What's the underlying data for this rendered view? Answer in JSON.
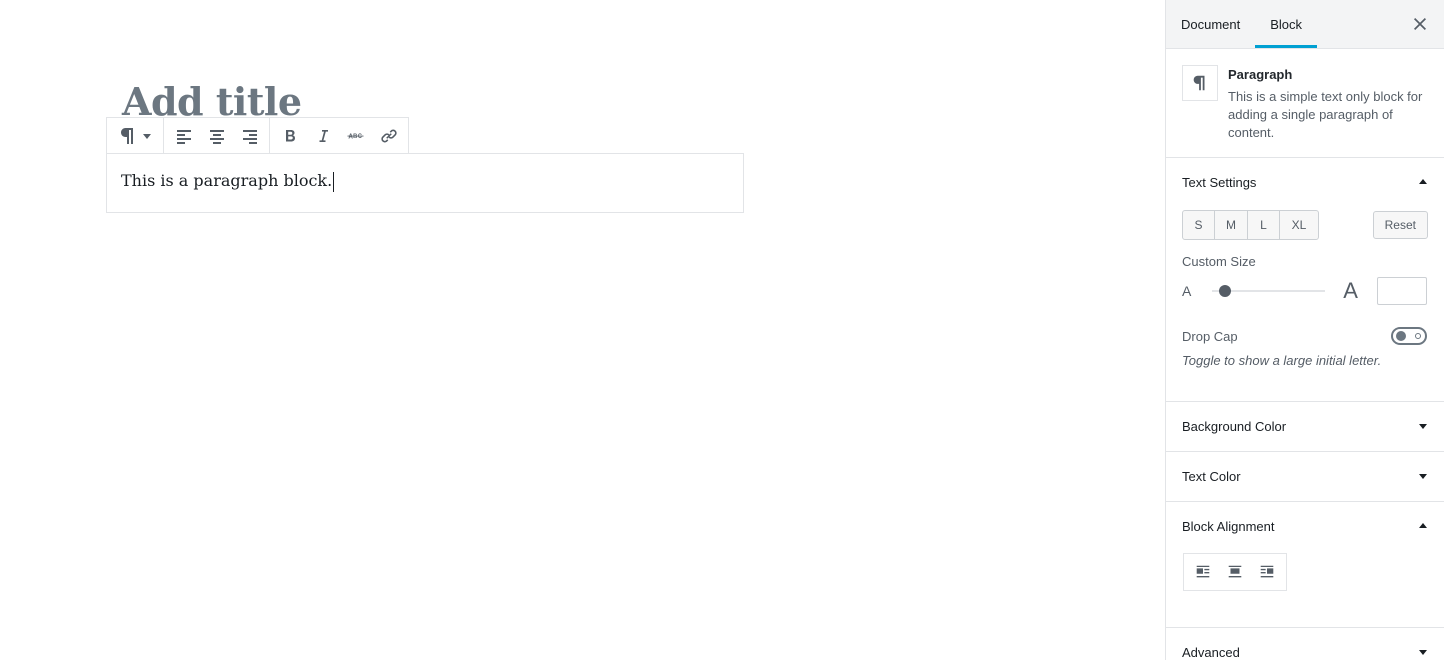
{
  "editor": {
    "title_placeholder": "Add title",
    "paragraph_text": "This is a paragraph block.",
    "toolbar": {
      "block_switcher_icon": "paragraph-icon",
      "alignment": [
        "align-left-icon",
        "align-center-icon",
        "align-right-icon"
      ],
      "formatting": [
        "bold-icon",
        "italic-icon",
        "strikethrough-icon",
        "link-icon"
      ]
    }
  },
  "sidebar": {
    "tabs": [
      {
        "label": "Document",
        "active": false
      },
      {
        "label": "Block",
        "active": true
      }
    ],
    "close_icon": "close-icon",
    "block_card": {
      "title": "Paragraph",
      "description": "This is a simple text only block for adding a single paragraph of content."
    },
    "text_settings": {
      "title": "Text Settings",
      "expanded": true,
      "sizes": [
        "S",
        "M",
        "L",
        "XL"
      ],
      "reset_label": "Reset",
      "custom_size_label": "Custom Size",
      "range_small_label": "A",
      "range_large_label": "A",
      "custom_size_value": "",
      "drop_cap_label": "Drop Cap",
      "drop_cap_enabled": false,
      "drop_cap_help": "Toggle to show a large initial letter."
    },
    "panels": {
      "background_color": "Background Color",
      "text_color": "Text Color",
      "block_alignment": "Block Alignment",
      "advanced": "Advanced"
    },
    "accent_color": "#00a0d2"
  }
}
